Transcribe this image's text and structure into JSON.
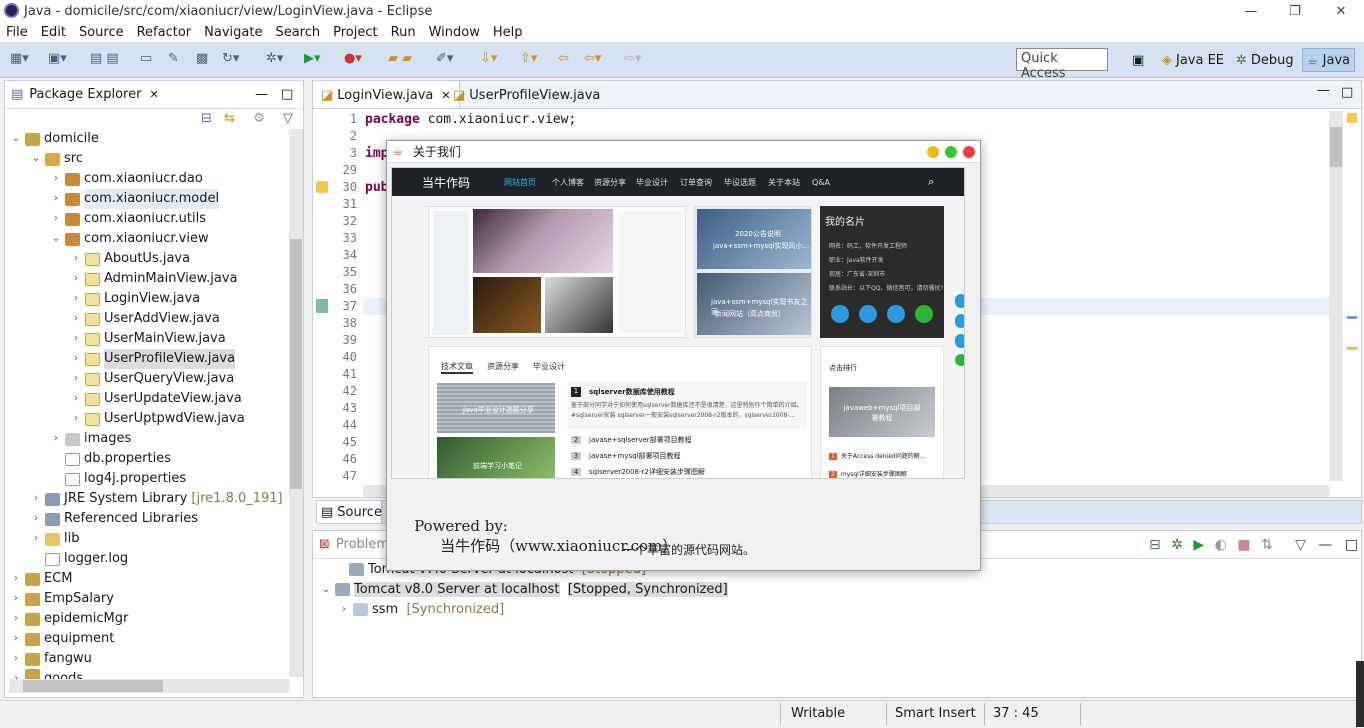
{
  "window": {
    "title": "Java - domicile/src/com/xiaoniucr/view/LoginView.java - Eclipse",
    "min": "—",
    "max": "❐",
    "close": "✕"
  },
  "menu": [
    "File",
    "Edit",
    "Source",
    "Refactor",
    "Navigate",
    "Search",
    "Project",
    "Run",
    "Window",
    "Help"
  ],
  "toolbar": {
    "quick_access": "Quick Access",
    "perspectives": [
      "Java EE",
      "Debug",
      "Java"
    ]
  },
  "package_explorer": {
    "title": "Package Explorer",
    "items": [
      {
        "label": "domicile"
      },
      {
        "label": "src"
      },
      {
        "label": "com.xiaoniucr.dao"
      },
      {
        "label": "com.xiaoniucr.model"
      },
      {
        "label": "com.xiaoniucr.utils"
      },
      {
        "label": "com.xiaoniucr.view"
      },
      {
        "label": "AboutUs.java"
      },
      {
        "label": "AdminMainView.java"
      },
      {
        "label": "LoginView.java"
      },
      {
        "label": "UserAddView.java"
      },
      {
        "label": "UserMainView.java"
      },
      {
        "label": "UserProfileView.java"
      },
      {
        "label": "UserQueryView.java"
      },
      {
        "label": "UserUpdateView.java"
      },
      {
        "label": "UserUptpwdView.java"
      },
      {
        "label": "images"
      },
      {
        "label": "db.properties"
      },
      {
        "label": "log4j.properties"
      },
      {
        "label": "JRE System Library",
        "extra": "[jre1.8.0_191]"
      },
      {
        "label": "Referenced Libraries"
      },
      {
        "label": "lib"
      },
      {
        "label": "logger.log"
      },
      {
        "label": "ECM"
      },
      {
        "label": "EmpSalary"
      },
      {
        "label": "epidemicMgr"
      },
      {
        "label": "equipment"
      },
      {
        "label": "fangwu"
      },
      {
        "label": "goods"
      }
    ]
  },
  "editor": {
    "tabs": [
      "LoginView.java",
      "UserProfileView.java"
    ],
    "lines": [
      {
        "n": "1",
        "code": "package com.xiaoniucr.view;"
      },
      {
        "n": "2",
        "code": ""
      },
      {
        "n": "3",
        "code": "imp"
      },
      {
        "n": "29",
        "code": ""
      },
      {
        "n": "30",
        "code": "pub"
      },
      {
        "n": "31",
        "code": ""
      },
      {
        "n": "32",
        "code": ""
      },
      {
        "n": "33",
        "code": ""
      },
      {
        "n": "34",
        "code": ""
      },
      {
        "n": "35",
        "code": ""
      },
      {
        "n": "36",
        "code": ""
      },
      {
        "n": "37",
        "code": ""
      },
      {
        "n": "38",
        "code": ""
      },
      {
        "n": "39",
        "code": ""
      },
      {
        "n": "40",
        "code": ""
      },
      {
        "n": "41",
        "code": ""
      },
      {
        "n": "42",
        "code": ""
      },
      {
        "n": "43",
        "code": ""
      },
      {
        "n": "44",
        "code": ""
      },
      {
        "n": "45",
        "code": ""
      },
      {
        "n": "46",
        "code": ""
      },
      {
        "n": "47",
        "code": ""
      }
    ],
    "bottom_tab": "Source"
  },
  "servers": {
    "tab": "Problems",
    "rows": [
      {
        "label": "Tomcat v7.0 Server at localhost",
        "status": "[Stopped]"
      },
      {
        "label": "Tomcat v8.0 Server at localhost",
        "status": "[Stopped, Synchronized]"
      },
      {
        "label": "ssm",
        "status": "[Synchronized]"
      }
    ]
  },
  "dialog": {
    "title": "关于我们",
    "powered_by": "Powered by:",
    "site_name": "当牛作码（www.xiaoniucr.com）",
    "tagline": "一个丰富的源代码网站。",
    "site": {
      "logo": "当牛作码",
      "nav": [
        "网站首页",
        "个人博客",
        "资源分享",
        "毕业设计",
        "订单查询",
        "毕设选题",
        "关于本站",
        "Q&A"
      ],
      "card_title": "我的名片",
      "card_lines": [
        "网名：码工，软件开发工程师",
        "职业：Java软件开发",
        "现居：广东省-深圳市",
        "联系站长：以下QQ、微信皆可，请勿骚扰！"
      ],
      "thumb1": "2020公告说明",
      "thumb2": "java+ssm+mysql实现风小...",
      "thumb3": "java+ssm+mysql实现书友之家",
      "thumb4": "新闻网站（高点商贸）",
      "tabs": [
        "技术文章",
        "资源分享",
        "毕业设计"
      ],
      "article_thumb1": "Java毕业设计选题分享",
      "article_thumb2": "前端学习小笔记",
      "articles": [
        {
          "n": "1",
          "t": "sqlserver数据库使用教程"
        },
        {
          "n": "2",
          "t": "javase+sqlserver部署项目教程"
        },
        {
          "n": "3",
          "t": "javase+mysql部署项目教程"
        },
        {
          "n": "4",
          "t": "sqlserver2008-r2详细安装步骤图解"
        }
      ],
      "article_desc": "鉴于部分同学对于如何使用sqlserver数据库还不是很清楚，这里特别作个简单的介绍。#sqlserver安装 sqlserver一般安装sqlserver2008-r2版本的，sqlserver2008-...",
      "rank_title": "点击排行",
      "rank_thumb": "javaweb+mysql项目部署教程",
      "ranks": [
        {
          "n": "1",
          "t": "关于Access denied问题的解..."
        },
        {
          "n": "2",
          "t": "mysql详细安装步骤图解"
        }
      ]
    }
  },
  "status": {
    "writable": "Writable",
    "insert": "Smart Insert",
    "pos": "37 : 45"
  }
}
